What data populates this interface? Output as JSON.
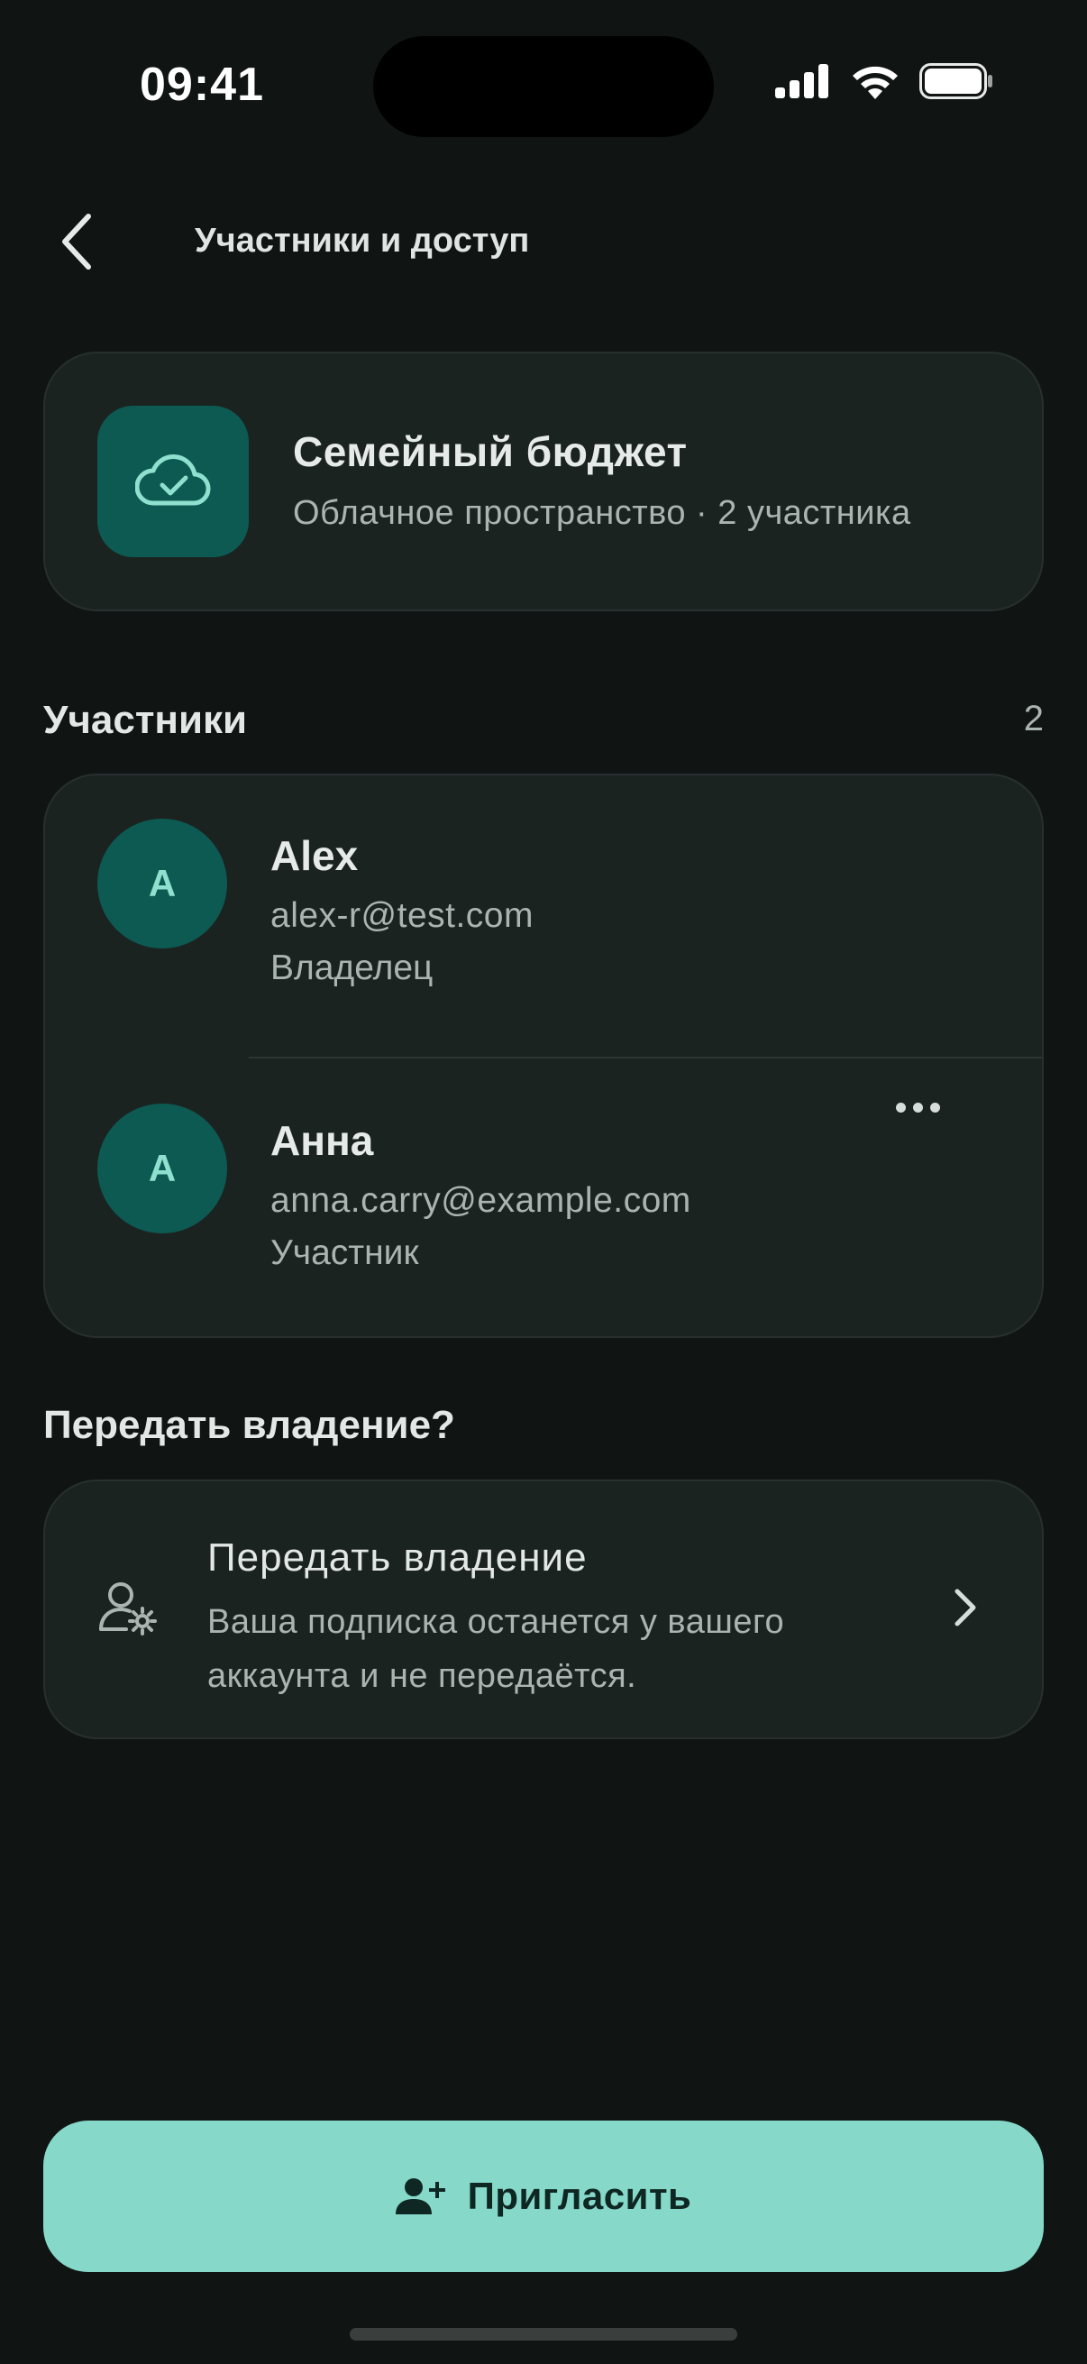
{
  "status_bar": {
    "time": "09:41"
  },
  "header": {
    "title": "Участники и доступ"
  },
  "space": {
    "name": "Семейный бюджет",
    "subtitle": "Облачное пространство · 2 участника",
    "icon": "cloud-check-icon"
  },
  "members_section": {
    "title": "Участники",
    "count": "2",
    "members": [
      {
        "initial": "A",
        "name": "Alex",
        "email": "alex-r@test.com",
        "role": "Владелец"
      },
      {
        "initial": "A",
        "name": "Анна",
        "email": "anna.carry@example.com",
        "role": "Участник"
      }
    ]
  },
  "transfer_section": {
    "title": "Передать владение?",
    "item_title": "Передать владение",
    "item_description": "Ваша подписка останется у вашего аккаунта и не передаётся."
  },
  "invite_button": {
    "label": "Пригласить"
  },
  "colors": {
    "background": "#101514",
    "card": "#1b2321",
    "accent": "#86d8c8",
    "avatar": "#0d5a52"
  }
}
